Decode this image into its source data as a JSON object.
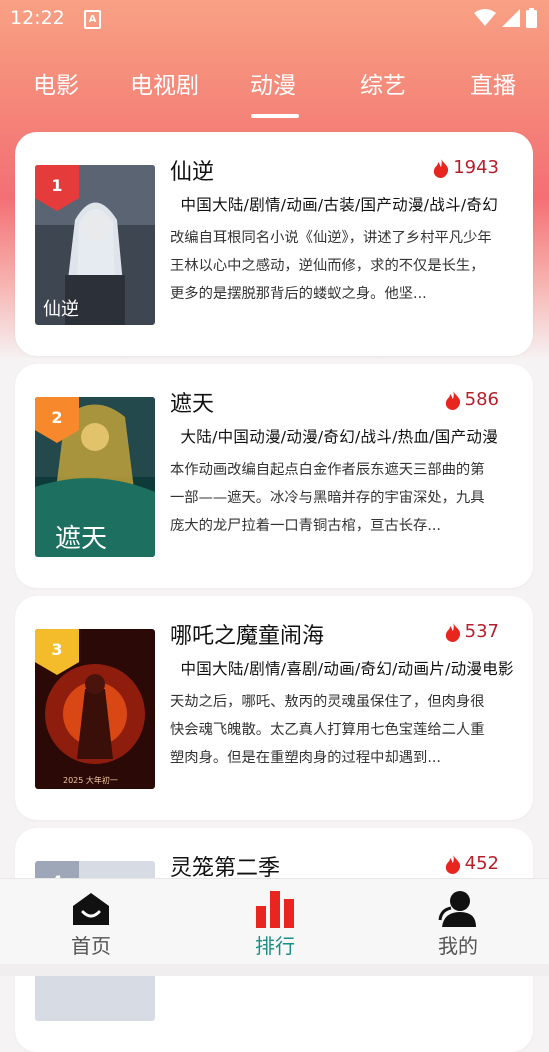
{
  "status_bar": {
    "time": "12:22",
    "notification_letter": "A"
  },
  "tabs": [
    "电影",
    "电视剧",
    "动漫",
    "综艺",
    "直播"
  ],
  "active_tab_index": 2,
  "items": [
    {
      "rank": "1",
      "title": "仙逆",
      "heat": "1943",
      "tags": "中国大陆/剧情/动画/古装/国产动漫/战斗/奇幻",
      "description": "改编自耳根同名小说《仙逆》，讲述了乡村平凡少年王林以心中之感动，逆仙而修，求的不仅是长生，更多的是摆脱那背后的蝼蚁之身。他坚...",
      "badge_color": "#e53b3b",
      "poster_text": "仙逆"
    },
    {
      "rank": "2",
      "title": "遮天",
      "heat": "586",
      "tags": "大陆/中国动漫/动漫/奇幻/战斗/热血/国产动漫",
      "description": "本作动画改编自起点白金作者辰东遮天三部曲的第一部——遮天。冰冷与黑暗并存的宇宙深处，九具庞大的龙尸拉着一口青铜古棺，亘古长存...",
      "badge_color": "#f7892c",
      "poster_text": "遮天"
    },
    {
      "rank": "3",
      "title": "哪吒之魔童闹海",
      "heat": "537",
      "tags": "中国大陆/剧情/喜剧/动画/奇幻/动画片/动漫电影",
      "description": "天劫之后，哪吒、敖丙的灵魂虽保住了，但肉身很快会魂飞魄散。太乙真人打算用七色宝莲给二人重塑肉身。但是在重塑肉身的过程中却遇到...",
      "badge_color": "#f4bb2a",
      "poster_text": "2025 大年初一"
    },
    {
      "rank": "4",
      "title": "灵笼第二季",
      "heat": "452",
      "tags": "",
      "description": "",
      "badge_color": "#9ea7b8",
      "poster_text": ""
    }
  ],
  "bottom_nav": [
    {
      "label": "首页",
      "icon": "home-icon"
    },
    {
      "label": "排行",
      "icon": "bar-chart-icon"
    },
    {
      "label": "我的",
      "icon": "user-icon"
    }
  ],
  "active_nav_index": 1,
  "colors": {
    "accent": "#1a8d84",
    "heat": "#b7202b",
    "flame": "#e8251f"
  }
}
